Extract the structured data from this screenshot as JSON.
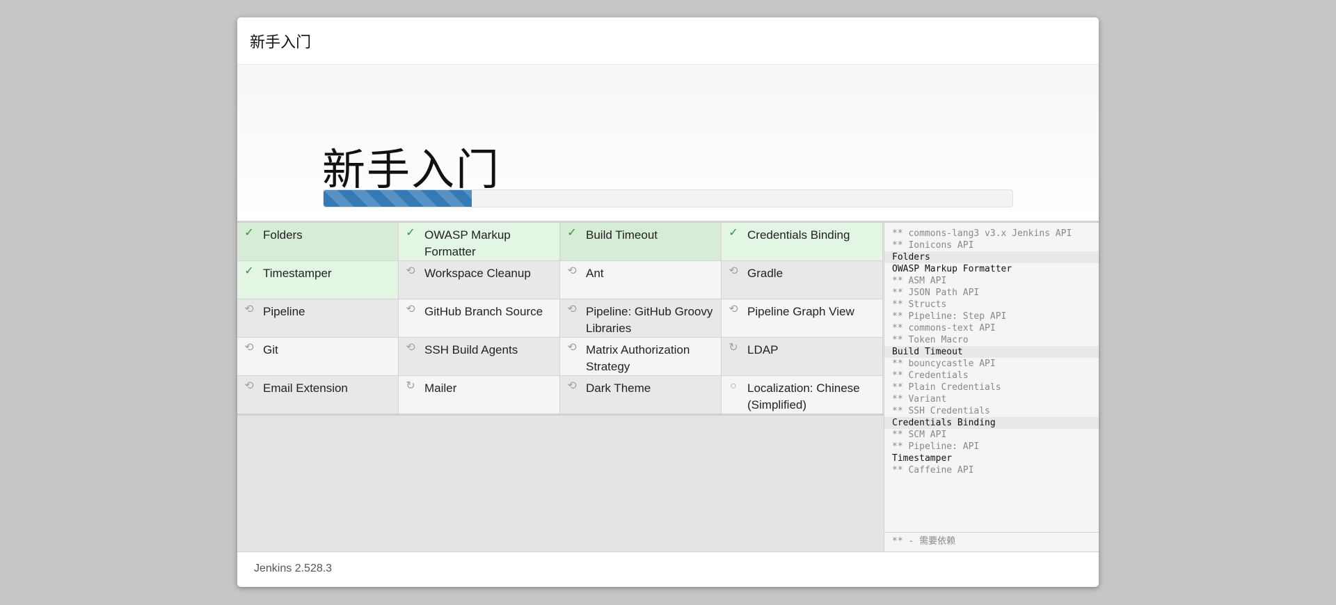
{
  "dialog": {
    "header_title": "新手入门",
    "hero_title": "新手入门",
    "progress_fraction": 0.215
  },
  "plugins": [
    {
      "label": "Folders",
      "status": "installed"
    },
    {
      "label": "OWASP Markup Formatter",
      "status": "installed"
    },
    {
      "label": "Build Timeout",
      "status": "installed"
    },
    {
      "label": "Credentials Binding",
      "status": "installed"
    },
    {
      "label": "Timestamper",
      "status": "installed"
    },
    {
      "label": "Workspace Cleanup",
      "status": "pending"
    },
    {
      "label": "Ant",
      "status": "pending"
    },
    {
      "label": "Gradle",
      "status": "pending"
    },
    {
      "label": "Pipeline",
      "status": "pending"
    },
    {
      "label": "GitHub Branch Source",
      "status": "pending"
    },
    {
      "label": "Pipeline: GitHub Groovy Libraries",
      "status": "pending"
    },
    {
      "label": "Pipeline Graph View",
      "status": "pending"
    },
    {
      "label": "Git",
      "status": "pending"
    },
    {
      "label": "SSH Build Agents",
      "status": "pending"
    },
    {
      "label": "Matrix Authorization Strategy",
      "status": "pending"
    },
    {
      "label": "LDAP",
      "status": "installing"
    },
    {
      "label": "Email Extension",
      "status": "pending"
    },
    {
      "label": "Mailer",
      "status": "installing"
    },
    {
      "label": "Dark Theme",
      "status": "pending"
    },
    {
      "label": "Localization: Chinese (Simplified)",
      "status": "waiting"
    }
  ],
  "install_log": [
    {
      "text": "** commons-lang3 v3.x Jenkins API",
      "kind": "dep"
    },
    {
      "text": "** Ionicons API",
      "kind": "dep"
    },
    {
      "text": "Folders",
      "kind": "head",
      "shade": true
    },
    {
      "text": "OWASP Markup Formatter",
      "kind": "head",
      "shade": false
    },
    {
      "text": "** ASM API",
      "kind": "dep"
    },
    {
      "text": "** JSON Path API",
      "kind": "dep"
    },
    {
      "text": "** Structs",
      "kind": "dep"
    },
    {
      "text": "** Pipeline: Step API",
      "kind": "dep"
    },
    {
      "text": "** commons-text API",
      "kind": "dep"
    },
    {
      "text": "** Token Macro",
      "kind": "dep"
    },
    {
      "text": "Build Timeout",
      "kind": "head",
      "shade": true
    },
    {
      "text": "** bouncycastle API",
      "kind": "dep"
    },
    {
      "text": "** Credentials",
      "kind": "dep"
    },
    {
      "text": "** Plain Credentials",
      "kind": "dep"
    },
    {
      "text": "** Variant",
      "kind": "dep"
    },
    {
      "text": "** SSH Credentials",
      "kind": "dep"
    },
    {
      "text": "Credentials Binding",
      "kind": "head",
      "shade": true
    },
    {
      "text": "** SCM API",
      "kind": "dep"
    },
    {
      "text": "** Pipeline: API",
      "kind": "dep"
    },
    {
      "text": "Timestamper",
      "kind": "head",
      "shade": false
    },
    {
      "text": "** Caffeine API",
      "kind": "dep"
    }
  ],
  "side_footer": "** - 需要依赖",
  "footer": {
    "version": "Jenkins 2.528.3"
  },
  "icons": {
    "installed": "check-icon",
    "pending": "refresh-icon",
    "installing": "spinner-icon",
    "waiting": "circle-icon"
  }
}
